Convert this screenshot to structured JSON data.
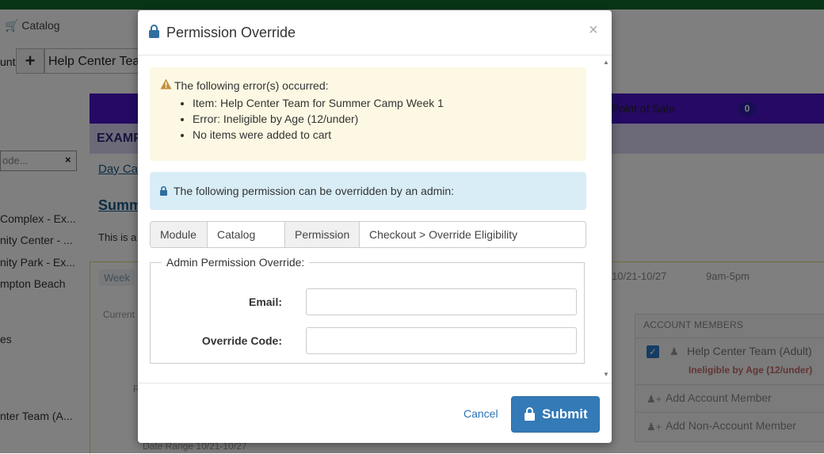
{
  "background": {
    "nav": {
      "catalog": "Catalog",
      "catalog_icon": "cart-icon"
    },
    "account": {
      "label": "unt",
      "plus": "+",
      "selected": "Help Center Team"
    },
    "search": {
      "placeholder": "ode...",
      "clear": "×"
    },
    "locations": [
      "Complex - Ex...",
      "nity Center - ...",
      "nity Park - Ex...",
      "mpton Beach",
      "es",
      "nter Team (A..."
    ],
    "tabs": {
      "point_of_sale": "Point of Sale",
      "badge": "0"
    },
    "example": "EXAMP",
    "breadcrumb": "Day Ca",
    "program_title": "Summ",
    "description": "This is a",
    "week": {
      "label": "Week",
      "dates": "10/21-10/27",
      "time": "9am-5pm"
    },
    "current": "Current",
    "r_label": "R",
    "date_range": {
      "label": "Date Range",
      "value": "10/21-10/27"
    },
    "members": {
      "title": "ACCOUNT MEMBERS",
      "member_name": "Help Center Team (Adult)",
      "member_error": "Ineligible by Age (12/under)",
      "add_account": "Add Account Member",
      "add_non_account": "Add Non-Account Member"
    }
  },
  "modal": {
    "title": "Permission Override",
    "close": "×",
    "warning": {
      "title": "The following error(s) occurred:",
      "items": [
        "Item: Help Center Team for Summer Camp Week 1",
        "Error: Ineligible by Age (12/under)",
        "No items were added to cart"
      ]
    },
    "info": "The following permission can be overridden by an admin:",
    "permission": {
      "module_label": "Module",
      "module_value": "Catalog",
      "permission_label": "Permission",
      "permission_value": "Checkout > Override Eligibility"
    },
    "override": {
      "legend": "Admin Permission Override:",
      "email_label": "Email:",
      "email_value": "",
      "code_label": "Override Code:",
      "code_value": ""
    },
    "footer": {
      "cancel": "Cancel",
      "submit": "Submit"
    }
  },
  "colors": {
    "topbar": "#0e6b2c",
    "accent_purple": "#4b12c9",
    "primary_button": "#337ab7",
    "warning_bg": "#fcf8e3",
    "info_bg": "#d9edf7"
  }
}
